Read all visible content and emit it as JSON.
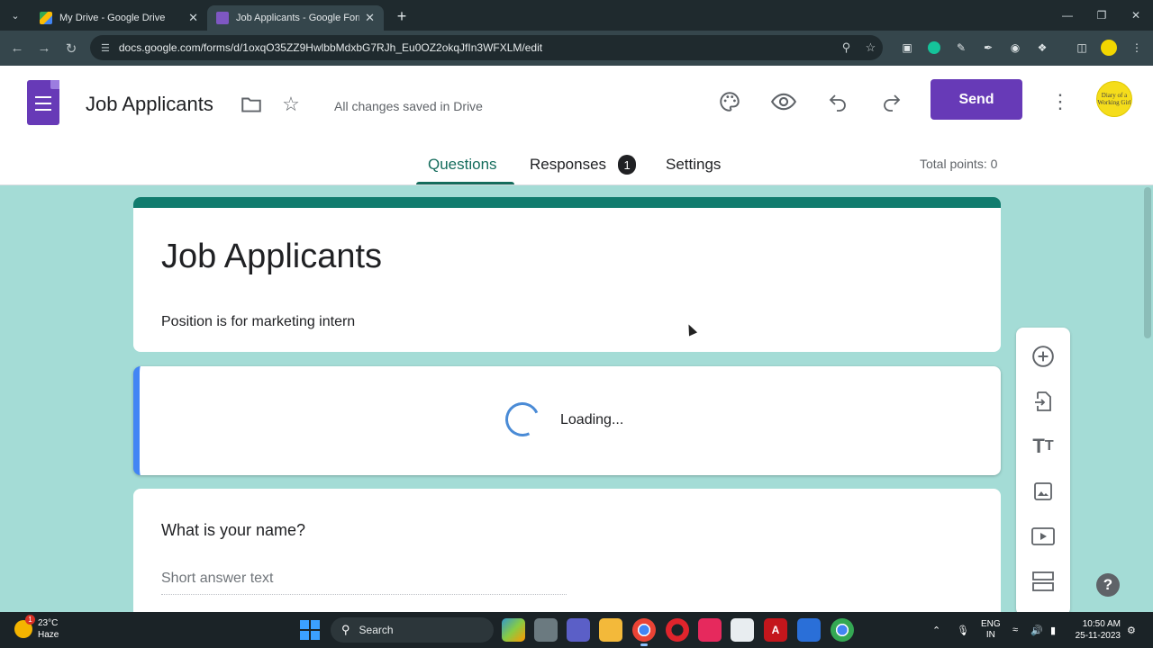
{
  "browser": {
    "tabs": [
      {
        "title": "My Drive - Google Drive",
        "active": false
      },
      {
        "title": "Job Applicants - Google Forms",
        "active": true
      }
    ],
    "url": "docs.google.com/forms/d/1oxqO35ZZ9HwlbbMdxbG7RJh_Eu0OZ2okqJfIn3WFXLM/edit"
  },
  "header": {
    "doc_title": "Job Applicants",
    "save_status": "All changes saved in Drive",
    "send_label": "Send",
    "avatar_text": "Diary of a Working Girl"
  },
  "nav": {
    "tabs": [
      {
        "label": "Questions",
        "active": true
      },
      {
        "label": "Responses",
        "badge": "1",
        "active": false
      },
      {
        "label": "Settings",
        "active": false
      }
    ],
    "total_points": "Total points: 0"
  },
  "form": {
    "title": "Job Applicants",
    "description": "Position is for marketing intern",
    "loading_text": "Loading...",
    "question": {
      "title": "What is your name?",
      "answer_placeholder": "Short answer text"
    }
  },
  "toolbar_icons": [
    "add-question-icon",
    "import-questions-icon",
    "add-title-icon",
    "add-image-icon",
    "add-video-icon",
    "add-section-icon"
  ],
  "colors": {
    "brand_purple": "#673ab7",
    "theme_teal": "#117c6e",
    "background": "#a4dcd6",
    "active_question_border": "#4285f4"
  },
  "taskbar": {
    "weather_temp": "23°C",
    "weather_desc": "Haze",
    "weather_alert": "1",
    "search_label": "Search",
    "lang_top": "ENG",
    "lang_bottom": "IN",
    "time": "10:50 AM",
    "date": "25-11-2023"
  }
}
